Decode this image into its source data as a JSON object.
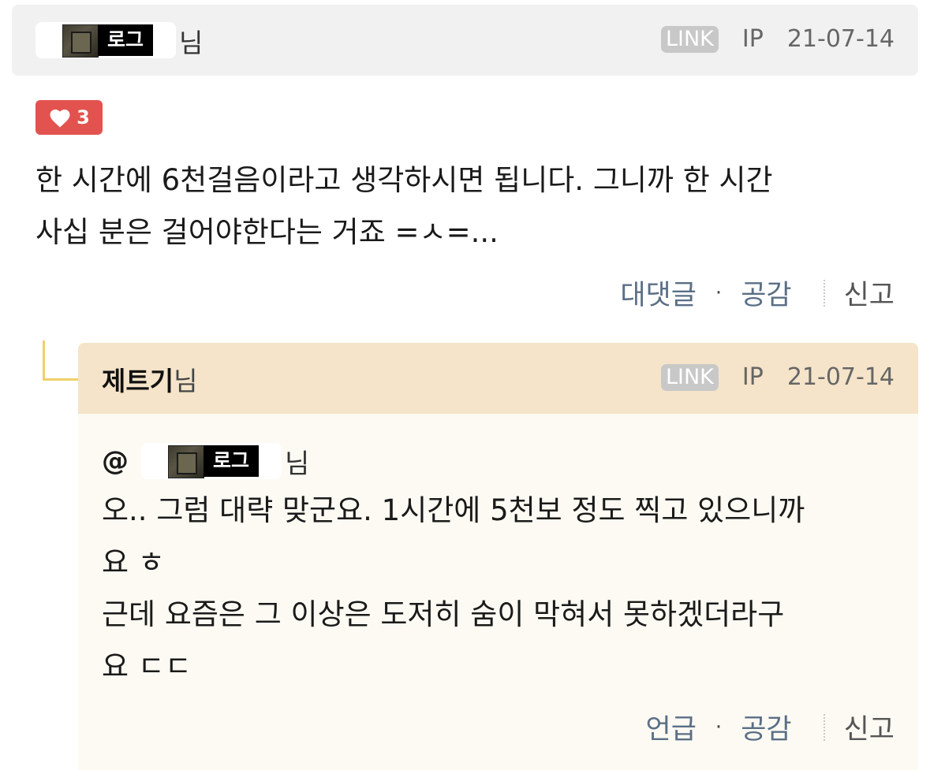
{
  "comment": {
    "author_tag": "로그",
    "honorific": "님",
    "link_badge": "LINK",
    "ip": "IP",
    "date": "21-07-14",
    "likes": "3",
    "text": "한 시간에 6천걸음이라고 생각하시면 됩니다. 그니까 한 시간\n사십 분은 걸어야한다는 거죠 =ㅅ=...",
    "actions": {
      "reply": "대댓글",
      "like": "공감",
      "report": "신고",
      "dot": "·"
    }
  },
  "reply": {
    "author": "제트기",
    "honorific": "님",
    "link_badge": "LINK",
    "ip": "IP",
    "date": "21-07-14",
    "mention_at": "@",
    "mention_tag": "로그",
    "mention_honorific": "님",
    "text": "오.. 그럼 대략 맞군요. 1시간에 5천보 정도 찍고 있으니까\n요 ㅎ\n근데 요즘은 그 이상은 도저히 숨이 막혀서 못하겠더라구\n요 ㄷㄷ",
    "actions": {
      "mention": "언급",
      "like": "공감",
      "report": "신고",
      "dot": "·"
    }
  },
  "colors": {
    "like_badge": "#e2534f",
    "reply_header": "#f5e4c9",
    "action_link": "#5b6f86"
  }
}
